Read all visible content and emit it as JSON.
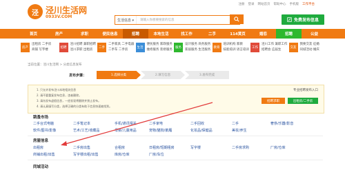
{
  "logo": {
    "badge": "泾",
    "name": "泾川生活网",
    "domain": "0933V.COM"
  },
  "topnav": [
    "注册",
    "登录",
    "网站首页",
    "帮助中心",
    "手机版",
    "工作平台"
  ],
  "search": {
    "category": "生活信息 ▾",
    "placeholder": "请输入你想要搜索的信息"
  },
  "post_button": "免费发布信息",
  "nav": [
    "首页",
    "房产",
    "求职",
    "便民信息",
    "招聘",
    "本地生活",
    "找工作",
    "二手",
    "114黄页",
    "婚恋",
    "招聘",
    "公益"
  ],
  "categories": [
    {
      "icon": "房产",
      "color": "#f07a12",
      "links": [
        "出租房  二手房",
        "商铺  写字楼"
      ]
    },
    {
      "icon": "招聘",
      "color": "#e04b3a",
      "links": [
        "泾川招聘  兼职招聘",
        "泾川求职  出租房"
      ]
    },
    {
      "icon": "二手",
      "color": "#f07a12",
      "links": [
        "二手家具  二手电器",
        "二手车  二手房"
      ]
    },
    {
      "icon": "生活",
      "color": "#3c8ed8",
      "links": [
        "便民服务  家政服务",
        "维修服务  装修服务"
      ]
    },
    {
      "icon": "服务",
      "color": "#2eb82e",
      "links": [
        "设计服务  商务服务",
        "家居服务  生活服务"
      ]
    },
    {
      "icon": "教育",
      "color": "#f07a12",
      "links": [
        "培训机构  家教",
        "技能培训  语言培训"
      ]
    },
    {
      "icon": "工作",
      "color": "#e04b3a",
      "links": [
        "泾川工作  兼职工作",
        "招聘会  应届生"
      ]
    },
    {
      "icon": "交友",
      "color": "#f07a12",
      "links": [
        "我要交友  征婚",
        "同城活动  婚庆"
      ]
    }
  ],
  "breadcrumb": "当前位置：泾川生活网 > 分类信息发布",
  "steps": {
    "label": "发布步骤：",
    "items": [
      "1.选择分类",
      "2.填写信息",
      "3.发布完成"
    ]
  },
  "notice": {
    "lines": [
      "1. 只允许发布泾川本地相关信息",
      "2. 请不要重复发布信息，违者删除。",
      "3. 请勿发布虚假信息，一经发现将删除并禁止发布。",
      "4. 请认真填写分类，选择正确的分类有助于信息快速被找到。"
    ],
    "highlight": "泾川",
    "entry_label": "专业招聘发布入口",
    "btn_recruit": "招聘求职",
    "btn_secondhand": "出租房/二手房"
  },
  "section1": {
    "title": "跳蚤市场",
    "rows": [
      [
        "二手台式电脑",
        "二手笔记本",
        "手机/通讯相关",
        "二手家电",
        "二手回收",
        "二手",
        "奢侈/乐器/影音"
      ],
      [
        "软件/图书/影像",
        "艺术/工艺/收藏品",
        "母婴/儿童用品",
        "宠物/猫狗/鹅雁",
        "化妆品/保健品",
        "美妆/养生"
      ]
    ]
  },
  "section2": {
    "title": "房屋信息",
    "rows": [
      [
        "出租房",
        "二手房出售",
        "合租房",
        "日租房/短期租房",
        "写字楼",
        "二手房求购",
        "厂房/仓库"
      ],
      [
        "商铺出租/出售",
        "写字楼出租/出售",
        "库房/仓库",
        "厂房/车位"
      ]
    ]
  },
  "section3": {
    "title": "同城活动"
  }
}
